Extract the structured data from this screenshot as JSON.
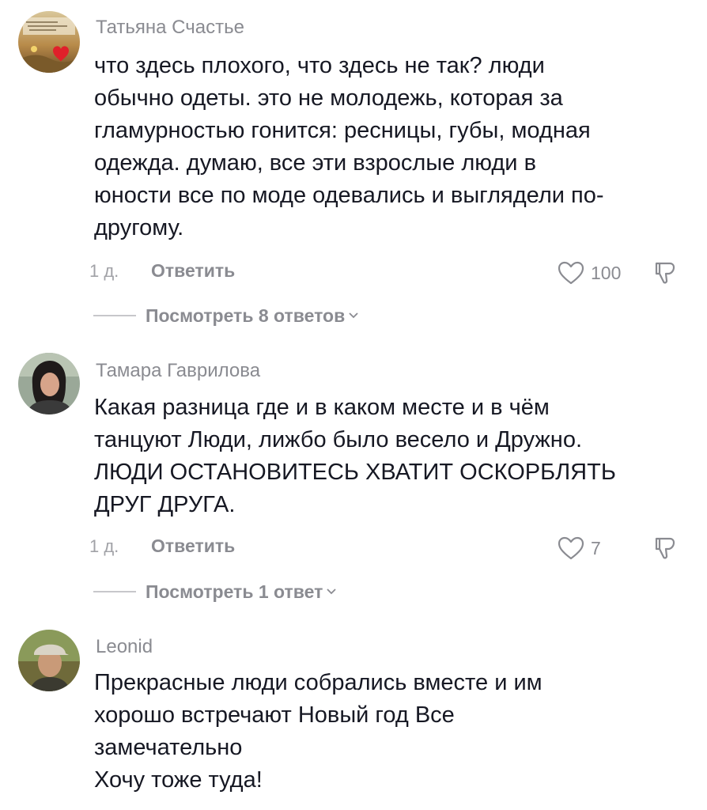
{
  "comments": [
    {
      "username": "Татьяна Счастье",
      "text_lines": [
        "что здесь плохого, что здесь не так? люди",
        "обычно одеты. это не молодежь, которая за",
        "гламурностью гонится: ресницы, губы, модная",
        "одежда. думаю, все эти взрослые люди в",
        "юности все по моде одевались и выглядели по-",
        "другому."
      ],
      "time": "1 д.",
      "reply_label": "Ответить",
      "likes": "100",
      "view_replies": "Посмотреть 8 ответов",
      "avatar_icon": "heart-collage-avatar"
    },
    {
      "username": "Тамара Гаврилова",
      "text_lines": [
        "Какая разница где и в каком месте и в чём",
        "танцуют Люди, лижбо было весело и Дружно.",
        "ЛЮДИ ОСТАНОВИТЕСЬ ХВАТИТ ОСКОРБЛЯТЬ",
        "ДРУГ ДРУГА."
      ],
      "time": "1 д.",
      "reply_label": "Ответить",
      "likes": "7",
      "view_replies": "Посмотреть 1 ответ",
      "avatar_icon": "woman-portrait-avatar"
    },
    {
      "username": "Leonid",
      "text_lines": [
        "Прекрасные люди собрались вместе и им",
        "хорошо встречают Новый год Все",
        "замечательно",
        "Хочу тоже туда!"
      ],
      "avatar_icon": "man-in-cap-avatar"
    }
  ],
  "icons": {
    "like": "heart-outline-icon",
    "dislike": "thumbs-down-icon",
    "expand": "chevron-down-icon"
  },
  "colors": {
    "text": "#161823",
    "secondary": "#8a8b91",
    "background": "#ffffff"
  }
}
